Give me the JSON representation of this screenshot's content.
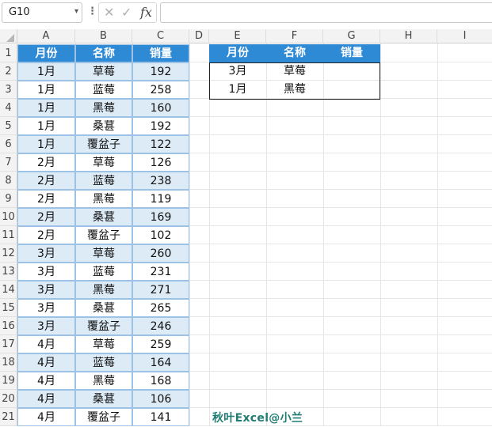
{
  "formula_bar": {
    "name_box": "G10",
    "fx_label": "fx",
    "formula": ""
  },
  "columns": [
    "A",
    "B",
    "C",
    "D",
    "E",
    "F",
    "G",
    "H",
    "I"
  ],
  "rows": [
    "1",
    "2",
    "3",
    "4",
    "5",
    "6",
    "7",
    "8",
    "9",
    "10",
    "11",
    "12",
    "13",
    "14",
    "15",
    "16",
    "17",
    "18",
    "19",
    "20",
    "21"
  ],
  "source_table": {
    "headers": [
      "月份",
      "名称",
      "销量"
    ],
    "rows": [
      [
        "1月",
        "草莓",
        "192"
      ],
      [
        "1月",
        "蓝莓",
        "258"
      ],
      [
        "1月",
        "黑莓",
        "160"
      ],
      [
        "1月",
        "桑葚",
        "192"
      ],
      [
        "1月",
        "覆盆子",
        "122"
      ],
      [
        "2月",
        "草莓",
        "126"
      ],
      [
        "2月",
        "蓝莓",
        "238"
      ],
      [
        "2月",
        "黑莓",
        "119"
      ],
      [
        "2月",
        "桑葚",
        "169"
      ],
      [
        "2月",
        "覆盆子",
        "102"
      ],
      [
        "3月",
        "草莓",
        "260"
      ],
      [
        "3月",
        "蓝莓",
        "231"
      ],
      [
        "3月",
        "黑莓",
        "271"
      ],
      [
        "3月",
        "桑葚",
        "265"
      ],
      [
        "3月",
        "覆盆子",
        "246"
      ],
      [
        "4月",
        "草莓",
        "259"
      ],
      [
        "4月",
        "蓝莓",
        "164"
      ],
      [
        "4月",
        "黑莓",
        "168"
      ],
      [
        "4月",
        "桑葚",
        "106"
      ],
      [
        "4月",
        "覆盆子",
        "141"
      ]
    ]
  },
  "lookup_table": {
    "headers": [
      "月份",
      "名称",
      "销量"
    ],
    "rows": [
      [
        "3月",
        "草莓",
        ""
      ],
      [
        "1月",
        "黑莓",
        ""
      ]
    ]
  },
  "watermark": "秋叶Excel@小兰",
  "colors": {
    "header_fill": "#2f8ad6",
    "zebra_fill": "#ddebf7",
    "watermark": "#1f7d73"
  }
}
